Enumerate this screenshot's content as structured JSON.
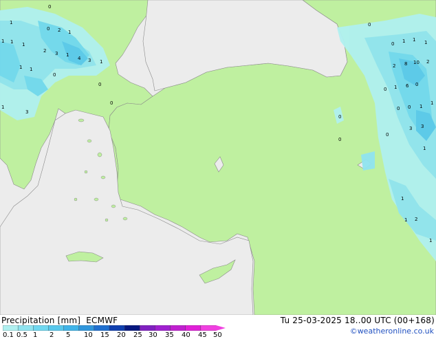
{
  "header": {
    "product": "Precipitation [mm]",
    "model": "ECMWF",
    "valid_time": "Tu 25-03-2025 18..00 UTC (00+168)"
  },
  "credit": "©weatheronline.co.uk",
  "legend": {
    "tick_labels": [
      "0.1",
      "0.5",
      "1",
      "2",
      "5",
      "10",
      "15",
      "20",
      "25",
      "30",
      "35",
      "40",
      "45",
      "50"
    ],
    "colors": [
      "#b0f0f0",
      "#90e4f0",
      "#70d8f0",
      "#58c8ec",
      "#40b4e8",
      "#3096dc",
      "#2070d0",
      "#1040b0",
      "#081880",
      "#8020c0",
      "#a020d0",
      "#c020d0",
      "#e020d8",
      "#f040e0"
    ]
  },
  "map": {
    "land_color": "#bff0a0",
    "sea_color": "#ececec",
    "point_values": [
      "0",
      "0",
      "2",
      "1",
      "1",
      "1",
      "2",
      "3",
      "1",
      "4",
      "3",
      "1",
      "1",
      "1",
      "1",
      "0",
      "0",
      "0",
      "1",
      "3",
      "1",
      "0",
      "0",
      "1",
      "1",
      "1",
      "2",
      "10",
      "8",
      "2",
      "1",
      "6",
      "0",
      "1",
      "0",
      "0",
      "0",
      "1",
      "0",
      "3",
      "3",
      "0",
      "0",
      "1",
      "1",
      "2",
      "1",
      "1"
    ]
  }
}
